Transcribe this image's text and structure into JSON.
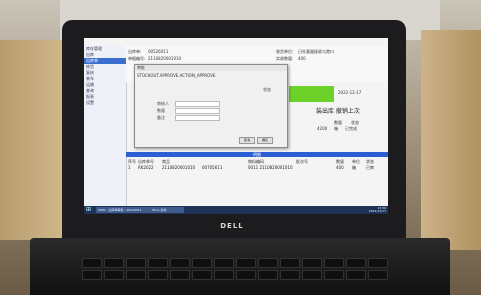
{
  "device": {
    "brand": "DELL"
  },
  "sidebar": {
    "items": [
      {
        "label": "库存管理"
      },
      {
        "label": "出库"
      },
      {
        "label": "出库单"
      },
      {
        "label": "拣货"
      },
      {
        "label": "复核"
      },
      {
        "label": "装车"
      },
      {
        "label": "运输"
      },
      {
        "label": "查询"
      },
      {
        "label": "报表"
      },
      {
        "label": "设置"
      }
    ]
  },
  "header": {
    "order_no_label": "出库单:",
    "order_no": "00526011",
    "doc_no_label": "单据编号:",
    "doc_no": "2110820001010",
    "date": "2022-12-17",
    "receiver_label": "收货单位:",
    "receiver": "日社客器接收与港口",
    "qty_label": "实收数量:",
    "qty_value": "400"
  },
  "status_text": "装出库 撤销上次",
  "dialog": {
    "title": "审批",
    "action": "STOCKOUT.APPROVE.ACTION_APPROVE",
    "status_label": "状态",
    "fields": [
      {
        "label": "审核人",
        "placeholder": ""
      },
      {
        "label": "数量",
        "placeholder": ""
      },
      {
        "label": "备注",
        "placeholder": ""
      }
    ],
    "ok_label": "确定",
    "cancel_label": "取消"
  },
  "detail_bar_label": "明细",
  "grid": {
    "columns": [
      "序号",
      "出库单号",
      "商品",
      "物料编码",
      "批次号",
      "数量",
      "单位",
      "状态"
    ],
    "rows": [
      [
        "1",
        "RK2022",
        "2110820001010",
        "00705611",
        "0011 2110820001010",
        "400",
        "箱",
        "已审"
      ]
    ]
  },
  "right_table": {
    "header": [
      "数量",
      "状态"
    ],
    "row": [
      "4200",
      "箱",
      "已完成"
    ]
  },
  "taskbar": {
    "app1": "WMS - 出库单审批 - 00526011",
    "app2": "Wms 系统",
    "time": "13:36",
    "date": "2022/12/17"
  }
}
